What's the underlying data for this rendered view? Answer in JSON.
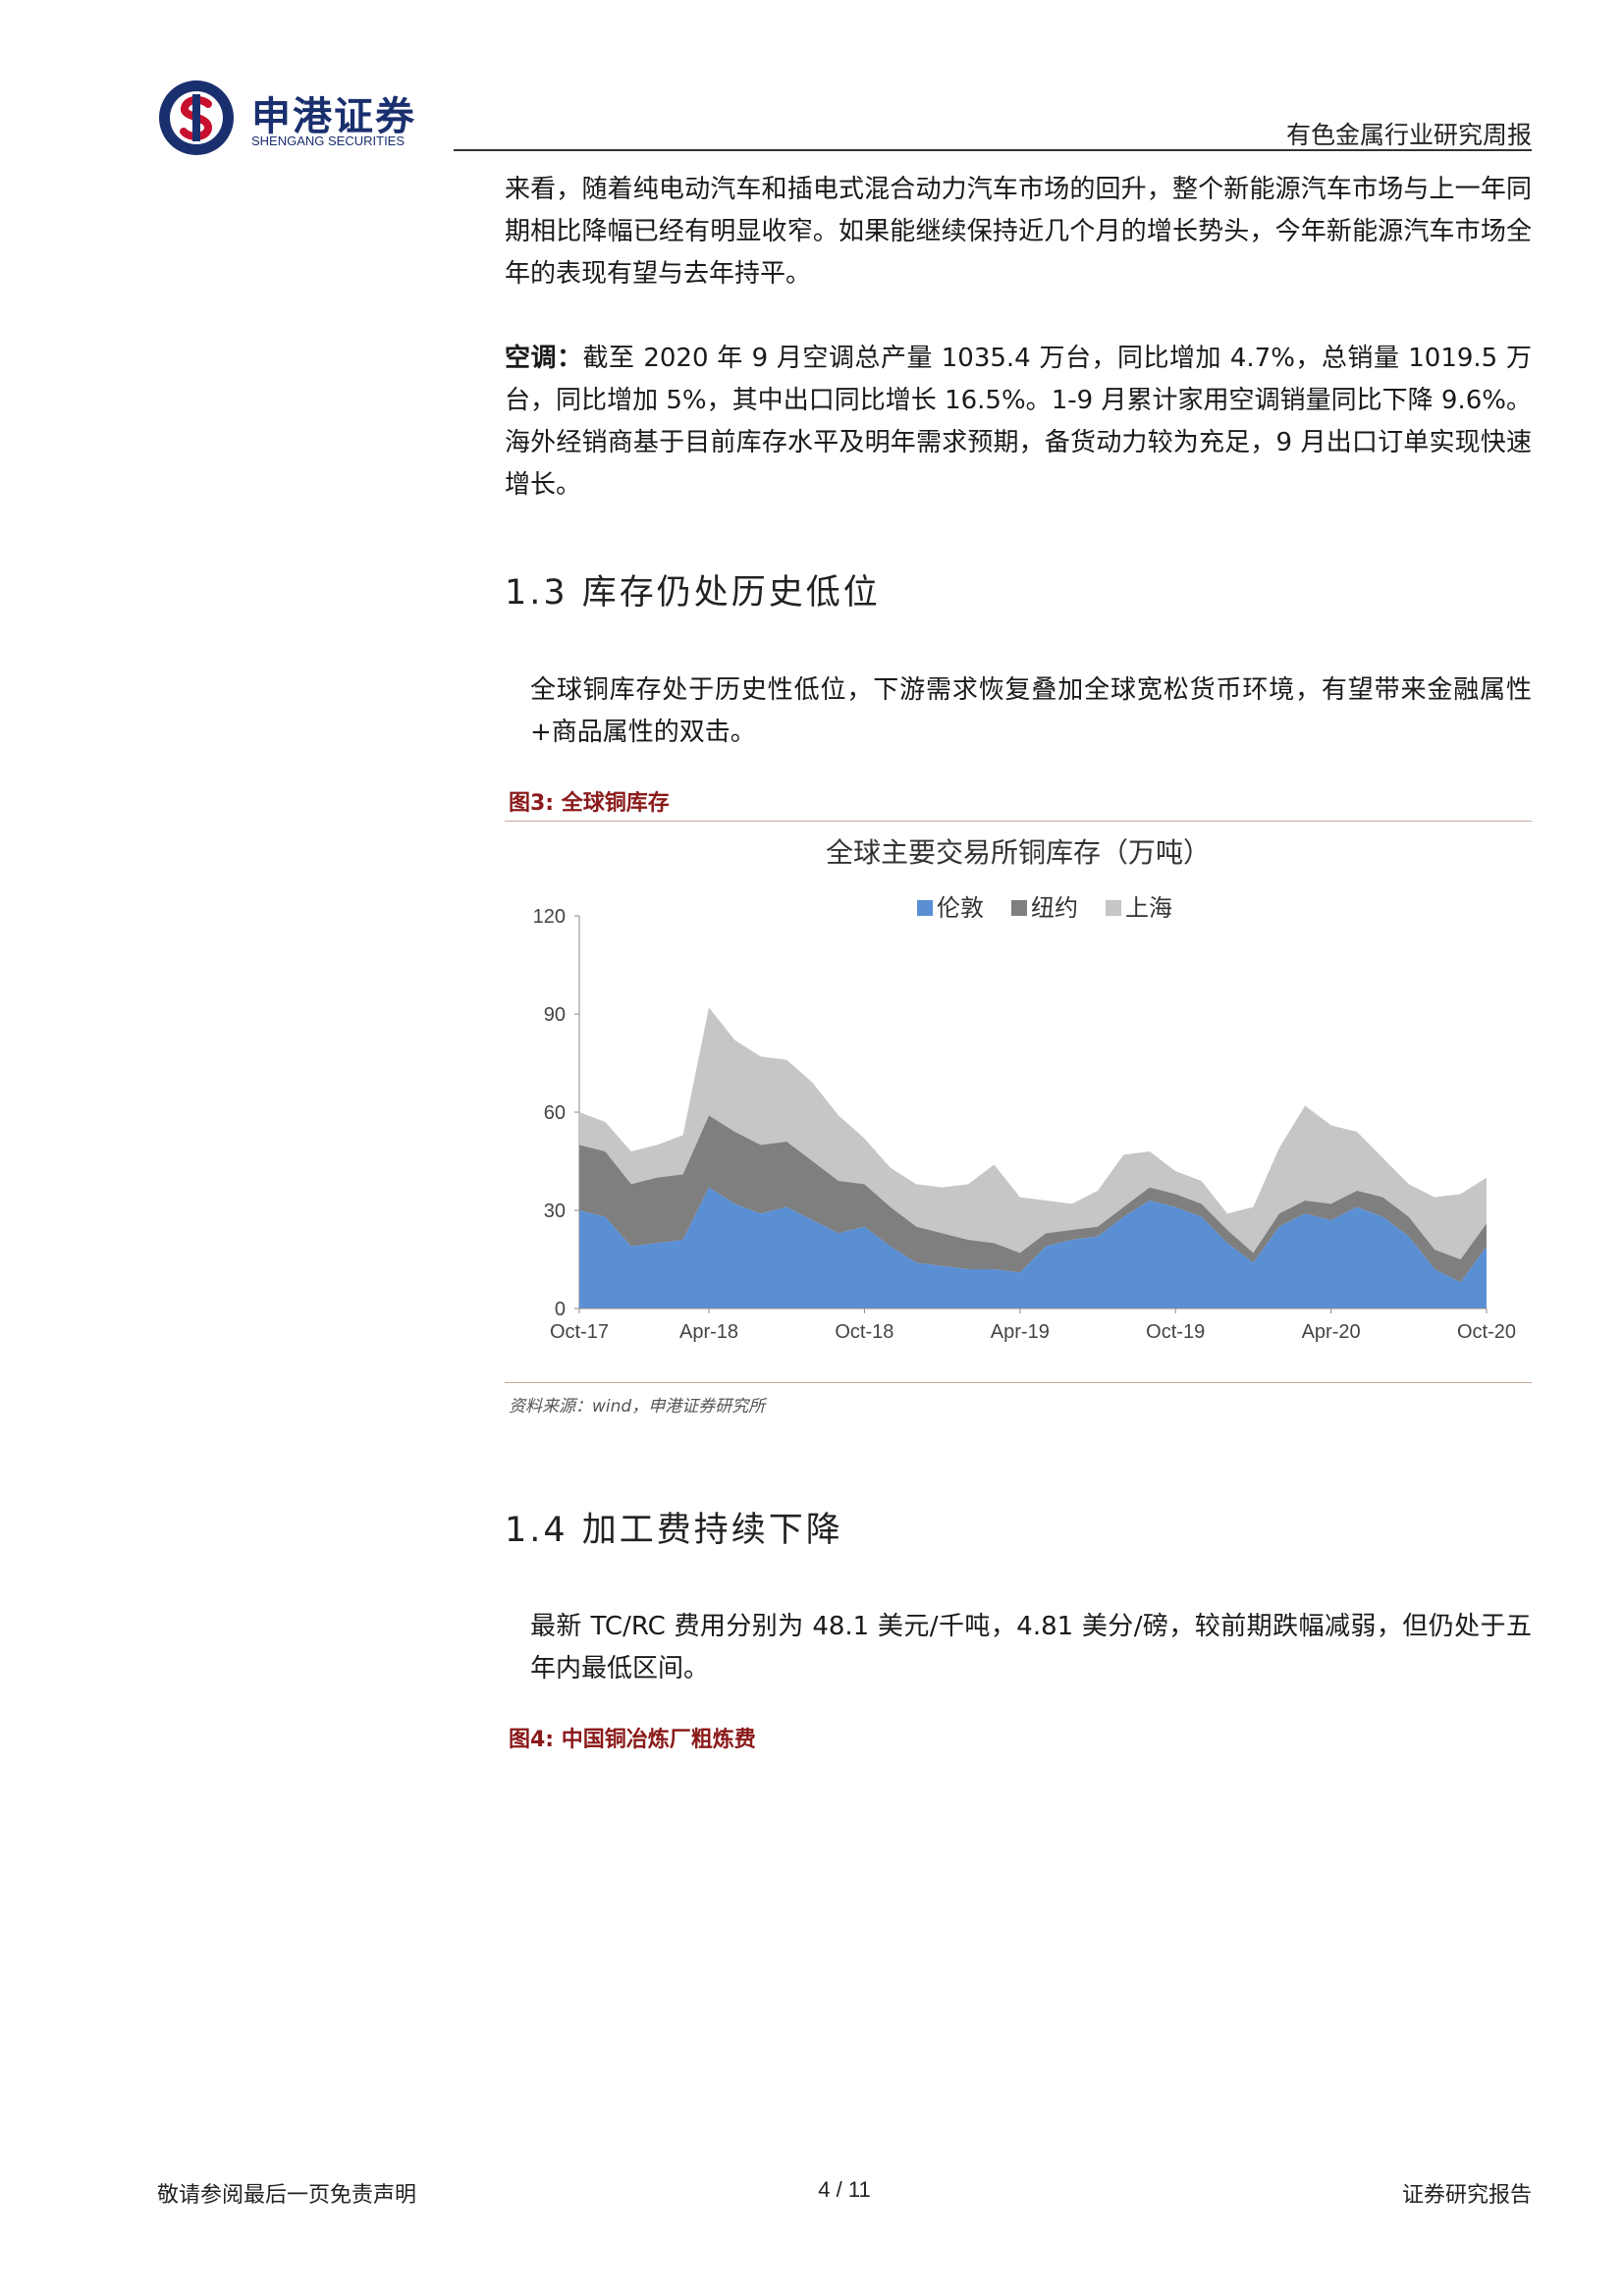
{
  "header": {
    "logo_cn": "申港证券",
    "logo_en": "SHENGANG SECURITIES",
    "report_type": "有色金属行业研究周报",
    "brand_color": "#1a2f6e",
    "accent_color": "#c8102e"
  },
  "body": {
    "intro_paragraph": "来看，随着纯电动汽车和插电式混合动力汽车市场的回升，整个新能源汽车市场与上一年同期相比降幅已经有明显收窄。如果能继续保持近几个月的增长势头，今年新能源汽车市场全年的表现有望与去年持平。",
    "ac_label": "空调：",
    "ac_text": "截至 2020 年 9 月空调总产量 1035.4 万台，同比增加 4.7%，总销量 1019.5 万台，同比增加 5%，其中出口同比增长 16.5%。1-9 月累计家用空调销量同比下降 9.6%。海外经销商基于目前库存水平及明年需求预期，备货动力较为充足，9 月出口订单实现快速增长。",
    "section_1_3": "1.3 库存仍处历史低位",
    "inventory_text": "全球铜库存处于历史性低位，下游需求恢复叠加全球宽松货币环境，有望带来金融属性+商品属性的双击。",
    "fig3_label": "图3:  全球铜库存",
    "fig3_source": "资料来源：wind，申港证券研究所",
    "section_1_4": "1.4 加工费持续下降",
    "tcrc_text": "最新 TC/RC 费用分别为 48.1 美元/千吨，4.81 美分/磅，较前期跌幅减弱，但仍处于五年内最低区间。",
    "fig4_label": "图4:  中国铜冶炼厂粗炼费"
  },
  "chart_data": {
    "type": "area",
    "stacked": true,
    "title": "全球主要交易所铜库存（万吨）",
    "ylim": [
      0,
      120
    ],
    "yticks": [
      0,
      30,
      60,
      90,
      120
    ],
    "x": [
      "Oct-17",
      "Dec-17",
      "Jan-18",
      "Feb-18",
      "Mar-18",
      "Apr-18",
      "May-18",
      "Jun-18",
      "Jul-18",
      "Aug-18",
      "Sep-18",
      "Oct-18",
      "Nov-18",
      "Dec-18",
      "Jan-19",
      "Feb-19",
      "Mar-19",
      "Apr-19",
      "May-19",
      "Jun-19",
      "Jul-19",
      "Aug-19",
      "Sep-19",
      "Oct-19",
      "Nov-19",
      "Dec-19",
      "Jan-20",
      "Feb-20",
      "Mar-20",
      "Apr-20",
      "May-20",
      "Jun-20",
      "Jul-20",
      "Aug-20",
      "Sep-20",
      "Oct-20"
    ],
    "xtick_labels": [
      "Oct-17",
      "Apr-18",
      "Oct-18",
      "Apr-19",
      "Oct-19",
      "Apr-20",
      "Oct-20"
    ],
    "legend_position": "top",
    "series": [
      {
        "name": "伦敦",
        "color": "#5b8fd4",
        "values": [
          30,
          28,
          19,
          20,
          21,
          37,
          32,
          29,
          31,
          27,
          23,
          25,
          19,
          14,
          13,
          12,
          12,
          11,
          19,
          21,
          22,
          28,
          33,
          31,
          28,
          20,
          14,
          25,
          29,
          27,
          31,
          28,
          22,
          12,
          8,
          19
        ]
      },
      {
        "name": "纽约",
        "color": "#7f7f7f",
        "values": [
          20,
          20,
          19,
          20,
          20,
          22,
          22,
          21,
          20,
          18,
          16,
          13,
          12,
          11,
          10,
          9,
          8,
          6,
          4,
          3,
          3,
          3,
          4,
          4,
          4,
          4,
          3,
          4,
          4,
          5,
          5,
          6,
          6,
          6,
          7,
          7
        ]
      },
      {
        "name": "上海",
        "color": "#c6c6c6",
        "values": [
          10,
          9,
          10,
          10,
          12,
          33,
          28,
          27,
          25,
          24,
          20,
          14,
          12,
          13,
          14,
          17,
          24,
          17,
          10,
          8,
          11,
          16,
          11,
          7,
          7,
          5,
          14,
          20,
          29,
          24,
          18,
          12,
          10,
          16,
          20,
          14
        ]
      }
    ]
  },
  "footer": {
    "disclaimer": "敬请参阅最后一页免责声明",
    "page": "4 / 11",
    "report_label": "证券研究报告"
  }
}
